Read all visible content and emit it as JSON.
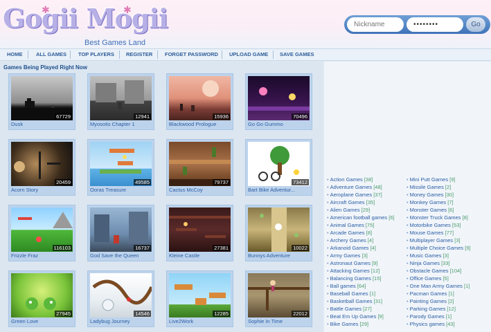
{
  "header": {
    "logo_text": "Gogii Mogii",
    "tagline": "Best Games Land",
    "login": {
      "nickname_placeholder": "Nickname",
      "password_value": "••••••••",
      "go_label": "Go"
    }
  },
  "nav": {
    "items": [
      {
        "label": "HOME"
      },
      {
        "label": "ALL GAMES"
      },
      {
        "label": "TOP PLAYERS"
      },
      {
        "label": "REGISTER"
      },
      {
        "label": "FORGET PASSWORD"
      },
      {
        "label": "UPLOAD GAME"
      },
      {
        "label": "SAVE GAMES"
      }
    ]
  },
  "main": {
    "section_title": "Games Being Played Right Now",
    "games": [
      {
        "title": "Dusk",
        "plays": "67729"
      },
      {
        "title": "Myosotis Chapter 1",
        "plays": "12941"
      },
      {
        "title": "Blackwood Prologue",
        "plays": "15936"
      },
      {
        "title": "Go Go Gummo",
        "plays": "70496"
      },
      {
        "title": "Acorn Story",
        "plays": "20459"
      },
      {
        "title": "Ooras Treasure",
        "plays": "49585"
      },
      {
        "title": "Cactus McCoy",
        "plays": "79737"
      },
      {
        "title": "Bart Bike Adventur...",
        "plays": "73412"
      },
      {
        "title": "Frizzle Fraz",
        "plays": "116103"
      },
      {
        "title": "God Save the Queen",
        "plays": "16737"
      },
      {
        "title": "Kleine Castle",
        "plays": "27381"
      },
      {
        "title": "Bunnys Adventure",
        "plays": "10022"
      },
      {
        "title": "Green Love",
        "plays": "27945"
      },
      {
        "title": "Ladybug Journey",
        "plays": "14546"
      },
      {
        "title": "Live2Work",
        "plays": "12285"
      },
      {
        "title": "Sophie In Time",
        "plays": "22012"
      }
    ]
  },
  "categories": {
    "left": [
      {
        "name": "Action Games",
        "count": "[38]"
      },
      {
        "name": "Adventure Games",
        "count": "[48]"
      },
      {
        "name": "Aeroplane Games",
        "count": "[37]"
      },
      {
        "name": "Aircraft Games",
        "count": "[35]"
      },
      {
        "name": "Alien Games",
        "count": "[29]"
      },
      {
        "name": "American football games",
        "count": "[6]"
      },
      {
        "name": "Animal Games",
        "count": "[75]"
      },
      {
        "name": "Arcade Games",
        "count": "[8]"
      },
      {
        "name": "Archery Games",
        "count": "[4]"
      },
      {
        "name": "Arkanoid Games",
        "count": "[4]"
      },
      {
        "name": "Army Games",
        "count": "[3]"
      },
      {
        "name": "Astronaut Games",
        "count": "[9]"
      },
      {
        "name": "Attacking Games",
        "count": "[12]"
      },
      {
        "name": "Balancing Games",
        "count": "[15]"
      },
      {
        "name": "Ball games",
        "count": "[64]"
      },
      {
        "name": "Baseball Games",
        "count": "[1]"
      },
      {
        "name": "Basketball Games",
        "count": "[31]"
      },
      {
        "name": "Battle Games",
        "count": "[27]"
      },
      {
        "name": "Beat Em Up Games",
        "count": "[9]"
      },
      {
        "name": "Bike Games",
        "count": "[29]"
      }
    ],
    "right": [
      {
        "name": "Mini Putt Games",
        "count": "[9]"
      },
      {
        "name": "Missile Games",
        "count": "[2]"
      },
      {
        "name": "Money Games",
        "count": "[30]"
      },
      {
        "name": "Monkey Games",
        "count": "[7]"
      },
      {
        "name": "Monster Games",
        "count": "[6]"
      },
      {
        "name": "Monster Truck Games",
        "count": "[8]"
      },
      {
        "name": "Motorbike Games",
        "count": "[53]"
      },
      {
        "name": "Mouse Games",
        "count": "[77]"
      },
      {
        "name": "Multiplayer Games",
        "count": "[3]"
      },
      {
        "name": "Multiple Choice Games",
        "count": "[9]"
      },
      {
        "name": "Music Games",
        "count": "[3]"
      },
      {
        "name": "Ninja Games",
        "count": "[33]"
      },
      {
        "name": "Obstacle Games",
        "count": "[104]"
      },
      {
        "name": "Office Games",
        "count": "[5]"
      },
      {
        "name": "One Man Army Games",
        "count": "[1]"
      },
      {
        "name": "Pacman Games",
        "count": "[1]"
      },
      {
        "name": "Painting Games",
        "count": "[2]"
      },
      {
        "name": "Parking Games",
        "count": "[12]"
      },
      {
        "name": "Parody Games",
        "count": "[1]"
      },
      {
        "name": "Physics games",
        "count": "[43]"
      }
    ]
  },
  "colors": {
    "link": "#2a5da3",
    "nav_text": "#2d5c9a",
    "card_bg": "#bdd3ec",
    "count_text": "#4a9a6a"
  }
}
